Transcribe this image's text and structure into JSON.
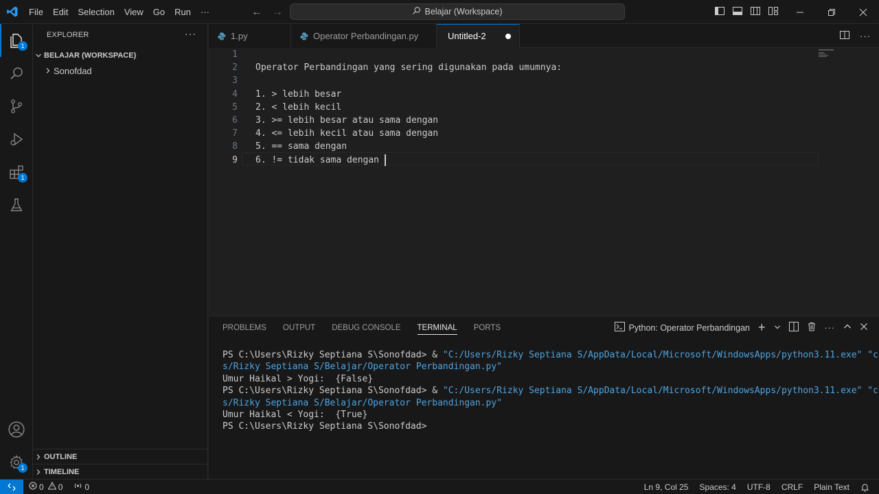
{
  "titlebar": {
    "menu": [
      "File",
      "Edit",
      "Selection",
      "View",
      "Go",
      "Run",
      "···"
    ],
    "search_text": "Belajar (Workspace)"
  },
  "activity": {
    "explorer_badge": "1",
    "extensions_badge": "1",
    "settings_badge": "1"
  },
  "sidebar": {
    "title": "EXPLORER",
    "more": "···",
    "workspace": "BELAJAR (WORKSPACE)",
    "folder": "Sonofdad",
    "outline": "OUTLINE",
    "timeline": "TIMELINE"
  },
  "tabs": [
    {
      "label": "1.py"
    },
    {
      "label": "Operator Perbandingan.py"
    },
    {
      "label": "Untitled-2"
    }
  ],
  "editor": {
    "lines": [
      {
        "n": "1",
        "text": ""
      },
      {
        "n": "2",
        "text": "Operator Perbandingan yang sering digunakan pada umumnya:"
      },
      {
        "n": "3",
        "text": ""
      },
      {
        "n": "4",
        "text": "1. > lebih besar"
      },
      {
        "n": "5",
        "text": "2. < lebih kecil"
      },
      {
        "n": "6",
        "text": "3. >= lebih besar atau sama dengan"
      },
      {
        "n": "7",
        "text": "4. <= lebih kecil atau sama dengan"
      },
      {
        "n": "8",
        "text": "5. == sama dengan"
      },
      {
        "n": "9",
        "text": "6. != tidak sama dengan "
      }
    ]
  },
  "panel": {
    "tabs": [
      "PROBLEMS",
      "OUTPUT",
      "DEBUG CONSOLE",
      "TERMINAL",
      "PORTS"
    ],
    "active_tab": "TERMINAL",
    "terminal_name": "Python: Operator Perbandingan",
    "terminal_lines": [
      {
        "prompt": "PS C:\\Users\\Rizky Septiana S\\Sonofdad> & ",
        "path": "\"C:/Users/Rizky Septiana S/AppData/Local/Microsoft/WindowsApps/python3.11.exe\" \"c:/User"
      },
      {
        "prompt": "",
        "path": "s/Rizky Septiana S/Belajar/Operator Perbandingan.py\""
      },
      {
        "prompt": "Umur Haikal > Yogi:  {False}",
        "path": ""
      },
      {
        "prompt": "PS C:\\Users\\Rizky Septiana S\\Sonofdad> & ",
        "path": "\"C:/Users/Rizky Septiana S/AppData/Local/Microsoft/WindowsApps/python3.11.exe\" \"c:/User"
      },
      {
        "prompt": "",
        "path": "s/Rizky Septiana S/Belajar/Operator Perbandingan.py\""
      },
      {
        "prompt": "Umur Haikal < Yogi:  {True}",
        "path": ""
      },
      {
        "prompt": "PS C:\\Users\\Rizky Septiana S\\Sonofdad>",
        "path": ""
      }
    ]
  },
  "status": {
    "errors": "0",
    "warnings": "0",
    "ports": "0",
    "position": "Ln 9, Col 25",
    "spaces": "Spaces: 4",
    "encoding": "UTF-8",
    "eol": "CRLF",
    "language": "Plain Text"
  },
  "colors": {
    "accent": "#0078d4",
    "terminal_path": "#4fa3e0",
    "python_icon": "#519aba"
  }
}
